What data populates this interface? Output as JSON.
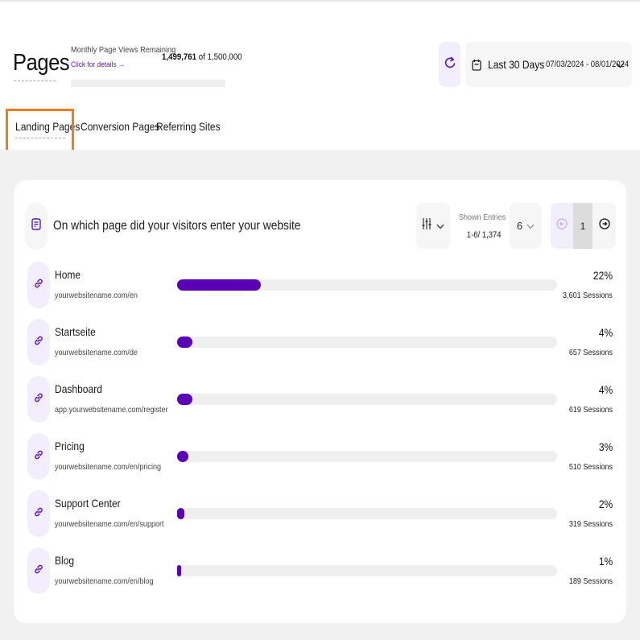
{
  "header": {
    "title": "Pages",
    "page_views_label": "Monthly Page Views Remaining",
    "details_link": "Click for details →",
    "page_views_used": "1,499,761",
    "page_views_of": "of 1,500,000",
    "page_views_remaining_fraction": 0.99984,
    "date_range_label": "Last 30 Days",
    "date_range_value": "07/03/2024 - 08/01/2024",
    "icons": {
      "refresh": "refresh-icon",
      "calendar": "calendar-icon",
      "chevron": "chevron-down-icon"
    }
  },
  "tabs": [
    {
      "label": "Landing Pages",
      "active": true
    },
    {
      "label": "Conversion Pages",
      "active": false
    },
    {
      "label": "Referring Sites",
      "active": false
    }
  ],
  "card": {
    "title": "On which page did your visitors enter your website",
    "shown_entries_label": "Shown Entries",
    "shown_entries_value": "1-6/ 1,374",
    "per_page": "6",
    "current_page": "1",
    "accent_color": "#5a00b5",
    "rows": [
      {
        "name": "Home",
        "url": "yourwebsitename.com/en",
        "percent_label": "22%",
        "percent": 22,
        "sessions": "3,601 Sessions"
      },
      {
        "name": "Startseite",
        "url": "yourwebsitename.com/de",
        "percent_label": "4%",
        "percent": 4,
        "sessions": "657 Sessions"
      },
      {
        "name": "Dashboard",
        "url": "app.yourwebsitename.com/register",
        "percent_label": "4%",
        "percent": 4,
        "sessions": "619 Sessions"
      },
      {
        "name": "Pricing",
        "url": "yourwebsitename.com/en/pricing",
        "percent_label": "3%",
        "percent": 3,
        "sessions": "510 Sessions"
      },
      {
        "name": "Support Center",
        "url": "yourwebsitename.com/en/support",
        "percent_label": "2%",
        "percent": 2,
        "sessions": "319 Sessions"
      },
      {
        "name": "Blog",
        "url": "yourwebsitename.com/en/blog",
        "percent_label": "1%",
        "percent": 1,
        "sessions": "189 Sessions"
      }
    ]
  }
}
